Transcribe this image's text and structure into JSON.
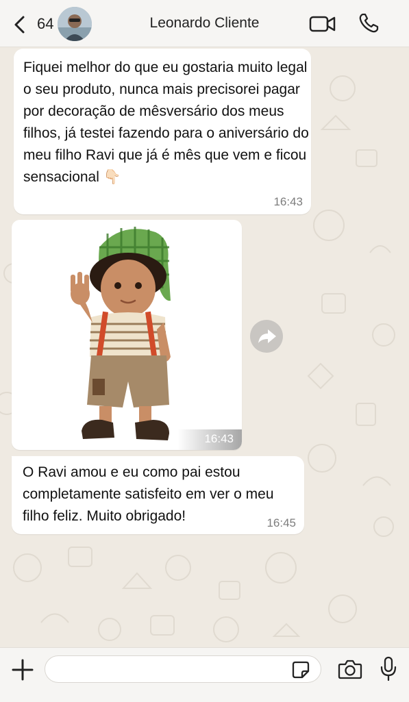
{
  "header": {
    "unread_count": "64",
    "contact_name": "Leonardo Cliente",
    "icons": [
      "back-icon",
      "avatar",
      "video-call-icon",
      "phone-call-icon"
    ]
  },
  "messages": [
    {
      "type": "text",
      "text": "Fiquei melhor do que eu gostaria muito legal o seu produto, nunca mais precisorei pagar por decoração de mêsversário dos meus filhos, já testei fazendo para o aniversário do meu filho Ravi que já é mês que vem e ficou sensacional 👇🏻",
      "time": "16:43"
    },
    {
      "type": "sticker",
      "sticker": "boy-in-green-checkered-cap-waving-sticker",
      "time": "16:43"
    },
    {
      "type": "text",
      "text": "O Ravi amou e eu como pai estou completamente satisfeito em ver o meu filho feliz. Muito obrigado!",
      "time": "16:45"
    }
  ],
  "composer": {
    "icons": [
      "add-icon",
      "sticker-icon",
      "camera-icon",
      "mic-icon"
    ]
  },
  "colors": {
    "header_bg": "#f6f5f3",
    "chat_bg": "#efeae2",
    "bubble_bg": "#ffffff",
    "text": "#111111",
    "timestamp": "#7d7d7d"
  }
}
